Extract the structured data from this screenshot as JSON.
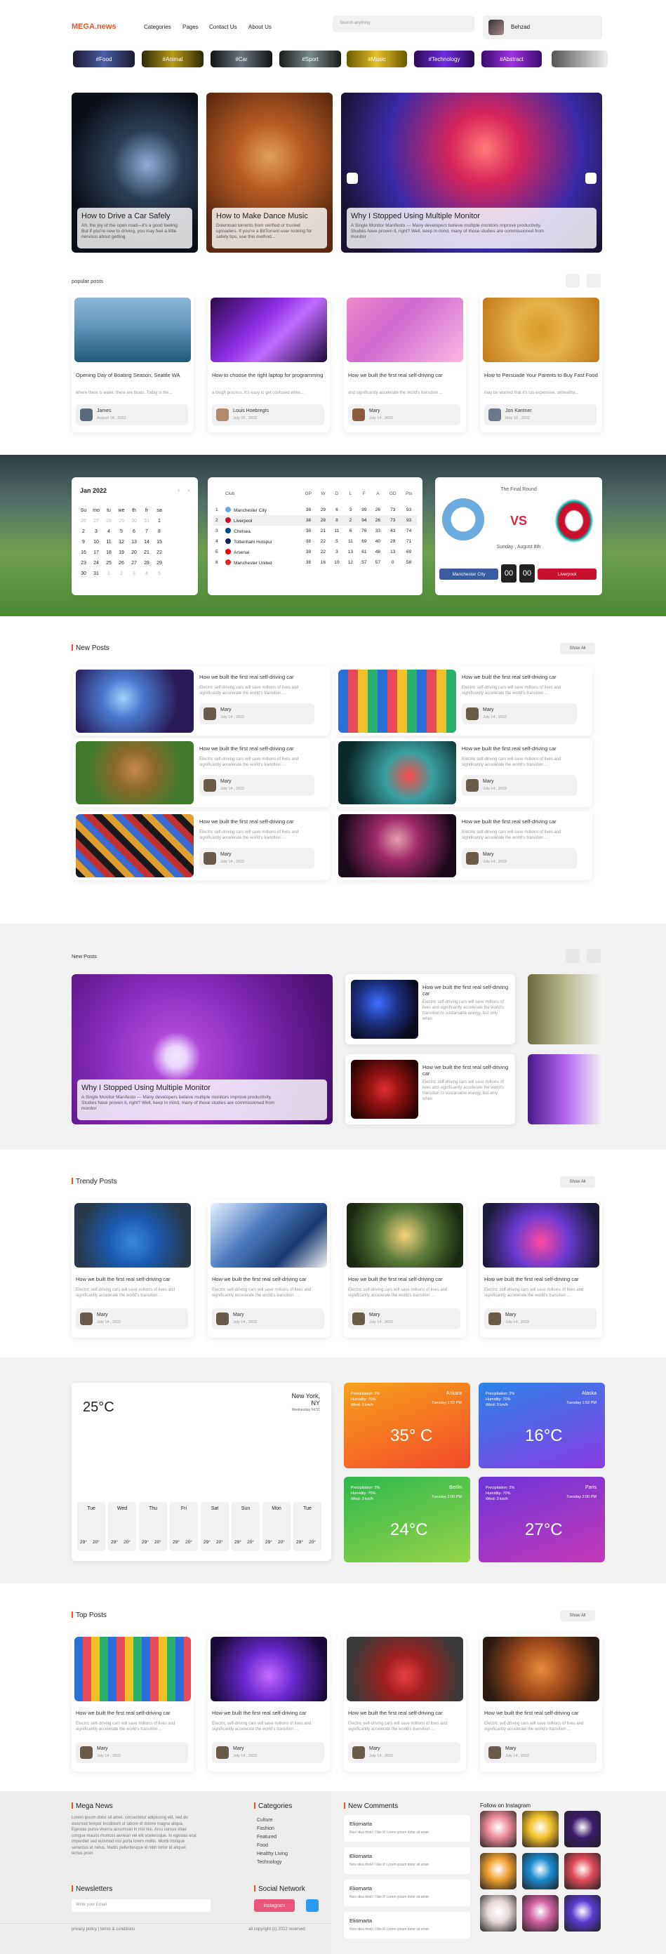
{
  "header": {
    "logo": "MEGA.news",
    "nav": [
      "Categories",
      "Pages",
      "Contact Us",
      "About Us"
    ],
    "search_placeholder": "Search anything",
    "user": "Behzad"
  },
  "tags": [
    "#Food",
    "#Animal",
    "#Car",
    "#Sport",
    "#Music",
    "#Technology",
    "#Abstract"
  ],
  "hero": [
    {
      "title": "How to Drive a Car Safely",
      "desc": "Ah, the joy of the open road—it's a good feeling. But if you're new to driving, you may feel a little nervous about getting"
    },
    {
      "title": "How to Make Dance Music",
      "desc": "Download torrents from verified or trusted uploaders. If you're a BitTorrent user looking for safety tips, use this method..."
    },
    {
      "title": "Why I Stopped Using Multiple Monitor",
      "desc": "A Single Monitor Manifesto — Many developers believe multiple monitors improve productivity. Studies have proven it, right? Well, keep in mind, many of those studies are commissioned from monitor"
    }
  ],
  "popular": {
    "heading": "popular posts",
    "cards": [
      {
        "title": "Opening Day of Boating Season, Seattle WA",
        "desc": "where there is water, there are boats. Today is the...",
        "author": "James",
        "date": "August 18 , 2022"
      },
      {
        "title": "How to choose the right laptop for programming",
        "desc": "a tough process. It's easy to get confused while...",
        "author": "Louis Hoebregts",
        "date": "July 25 , 2022"
      },
      {
        "title": "How we built the first real self-driving car",
        "desc": "and significantly accelerate the world's transition ...",
        "author": "Mary",
        "date": "July 14 , 2022"
      },
      {
        "title": "How to Persuade Your Parents to Buy Fast Food",
        "desc": "may be worried that it's too expensive, unhealthy...",
        "author": "Jon Kantner",
        "date": "May 10 , 2022"
      }
    ]
  },
  "calendar": {
    "month": "Jan 2022",
    "days": [
      "Su",
      "mo",
      "tu",
      "we",
      "th",
      "fr",
      "sa"
    ],
    "rows": [
      [
        "26",
        "27",
        "28",
        "29",
        "30",
        "31",
        "1"
      ],
      [
        "2",
        "3",
        "4",
        "5",
        "6",
        "7",
        "8"
      ],
      [
        "9",
        "10",
        "11",
        "12",
        "13",
        "14",
        "15"
      ],
      [
        "16",
        "17",
        "18",
        "19",
        "20",
        "21",
        "22"
      ],
      [
        "23",
        "24",
        "25",
        "26",
        "27",
        "28",
        "29"
      ],
      [
        "30",
        "31",
        "1",
        "2",
        "3",
        "4",
        "5"
      ]
    ]
  },
  "league": {
    "club_header": "Club",
    "cols": [
      "GP",
      "W",
      "D",
      "L",
      "F",
      "A",
      "GD",
      "Pts"
    ],
    "rows": [
      {
        "pos": "1",
        "club": "Manchester City",
        "vals": [
          "38",
          "29",
          "6",
          "3",
          "99",
          "26",
          "73",
          "93"
        ]
      },
      {
        "pos": "2",
        "club": "Liverpool",
        "vals": [
          "38",
          "28",
          "8",
          "2",
          "94",
          "26",
          "73",
          "93"
        ]
      },
      {
        "pos": "3",
        "club": "Chelsea",
        "vals": [
          "38",
          "21",
          "11",
          "6",
          "76",
          "33",
          "43",
          "74"
        ]
      },
      {
        "pos": "4",
        "club": "Tottenham Hotspur",
        "vals": [
          "38",
          "22",
          "5",
          "11",
          "69",
          "40",
          "29",
          "71"
        ]
      },
      {
        "pos": "5",
        "club": "Arsenal",
        "vals": [
          "38",
          "22",
          "3",
          "13",
          "61",
          "48",
          "13",
          "69"
        ]
      },
      {
        "pos": "6",
        "club": "Manchester United",
        "vals": [
          "38",
          "16",
          "10",
          "12",
          "57",
          "57",
          "0",
          "58"
        ]
      }
    ]
  },
  "match": {
    "round": "The Final Round",
    "vs": "VS",
    "date": "Sunday , August 8th",
    "home": "Manchester City",
    "away": "Liverpool",
    "score_home": "00",
    "score_away": "00",
    "home_color": "#3a5ba0",
    "away_color": "#c8102e"
  },
  "new_posts": {
    "heading": "New Posts",
    "show_all": "Show All",
    "cards": [
      {
        "title": "How we built the first real self-driving car",
        "desc": "Electric self-driving cars will save millions of lives and significantly accelerate the world's transition ...",
        "author": "Mary",
        "date": "July 14 , 2022"
      },
      {
        "title": "How we built the first real self-driving car",
        "desc": "Electric self-driving cars will save millions of lives and significantly accelerate the world's transition ...",
        "author": "Mary",
        "date": "July 14 , 2022"
      },
      {
        "title": "How we built the first real self-driving car",
        "desc": "Electric self-driving cars will save millions of lives and significantly accelerate the world's transition ...",
        "author": "Mary",
        "date": "July 14 , 2022"
      },
      {
        "title": "How we built the first real self-driving car",
        "desc": "Electric self-driving cars will save millions of lives and significantly accelerate the world's transition ...",
        "author": "Mary",
        "date": "July 14 , 2022"
      },
      {
        "title": "How we built the first real self-driving car",
        "desc": "Electric self-driving cars will save millions of lives and significantly accelerate the world's transition ...",
        "author": "Mary",
        "date": "July 14 , 2022"
      },
      {
        "title": "How we built the first real self-driving car",
        "desc": "Electric self-driving cars will save millions of lives and significantly accelerate the world's transition ...",
        "author": "Mary",
        "date": "July 14 , 2022"
      }
    ]
  },
  "new_posts2": {
    "heading": "New Posts",
    "feature_title": "Why I Stopped Using Multiple Monitor",
    "feature_desc": "A Single Monitor Manifesto — Many developers believe multiple monitors improve productivity. Studies have proven it, right? Well, keep in mind, many of those studies are commissioned from monitor",
    "side": [
      {
        "title": "How we built the first real self-driving car",
        "desc": "Electric self-driving cars will save millions of lives and significantly accelerate the world's transition to sustainable energy, but only when"
      },
      {
        "title": "How we built the first real self-driving car",
        "desc": "Electric self-driving cars will save millions of lives and significantly accelerate the world's transition to sustainable energy, but only when"
      }
    ]
  },
  "trendy": {
    "heading": "Trendy Posts",
    "show_all": "Show All",
    "cards": [
      {
        "title": "How we built the first real self-driving car",
        "desc": "Electric self-driving cars will save millions of lives and significantly accelerate the world's transition ...",
        "author": "Mary",
        "date": "July 14 , 2022"
      },
      {
        "title": "How we built the first real self-driving car",
        "desc": "Electric self-driving cars will save millions of lives and significantly accelerate the world's transition ...",
        "author": "Mary",
        "date": "July 14 , 2022"
      },
      {
        "title": "How we built the first real self-driving car",
        "desc": "Electric self-driving cars will save millions of lives and significantly accelerate the world's transition ...",
        "author": "Mary",
        "date": "July 14 , 2022"
      },
      {
        "title": "How we built the first real self-driving car",
        "desc": "Electric self-driving cars will save millions of lives and significantly accelerate the world's transition ...",
        "author": "Mary",
        "date": "July 14 , 2022"
      }
    ]
  },
  "weather": {
    "current_temp": "25°C",
    "city": "New York, NY",
    "day": "Wednesday 04:51",
    "week": [
      {
        "d": "Tue",
        "hi": "29°",
        "lo": "20°"
      },
      {
        "d": "Wed",
        "hi": "29°",
        "lo": "20°"
      },
      {
        "d": "Thu",
        "hi": "29°",
        "lo": "20°"
      },
      {
        "d": "Fri",
        "hi": "29°",
        "lo": "20°"
      },
      {
        "d": "Sat",
        "hi": "29°",
        "lo": "20°"
      },
      {
        "d": "Sun",
        "hi": "29°",
        "lo": "20°"
      },
      {
        "d": "Mon",
        "hi": "29°",
        "lo": "20°"
      },
      {
        "d": "Tue",
        "hi": "29°",
        "lo": "20°"
      }
    ],
    "cities": [
      {
        "city": "Ankara",
        "temp": "35° C",
        "p": "Precipitation: 2%",
        "h": "Humidity: 70%",
        "w": "Wind: 3 km/h",
        "time": "Tuesday 1:53 PM",
        "c1": "#f6a21c",
        "c2": "#f2492a"
      },
      {
        "city": "Alaska",
        "temp": "16°C",
        "p": "Precipitation: 2%",
        "h": "Humidity: 70%",
        "w": "Wind: 3 km/h",
        "time": "Tuesday 1:53 PM",
        "c1": "#2b84e8",
        "c2": "#8a3ce3"
      },
      {
        "city": "Berlin",
        "temp": "24°C",
        "p": "Precipitation: 2%",
        "h": "Humidity: 70%",
        "w": "Wind: 3 km/h",
        "time": "Tuesday 2:00 PM",
        "c1": "#2db84a",
        "c2": "#96d44a"
      },
      {
        "city": "Paris",
        "temp": "27°C",
        "p": "Precipitation: 2%",
        "h": "Humidity: 70%",
        "w": "Wind: 3 km/h",
        "time": "Tuesday 2:00 PM",
        "c1": "#6a35d8",
        "c2": "#c738b8"
      }
    ]
  },
  "top": {
    "heading": "Top Posts",
    "show_all": "Show All",
    "cards": [
      {
        "title": "How we built the first real self-driving car",
        "desc": "Electric self-driving cars will save millions of lives and significantly accelerate the world's transition ...",
        "author": "Mary",
        "date": "July 14 , 2022"
      },
      {
        "title": "How we built the first real self-driving car",
        "desc": "Electric self-driving cars will save millions of lives and significantly accelerate the world's transition ...",
        "author": "Mary",
        "date": "July 14 , 2022"
      },
      {
        "title": "How we built the first real self-driving car",
        "desc": "Electric self-driving cars will save millions of lives and significantly accelerate the world's transition ...",
        "author": "Mary",
        "date": "July 14 , 2022"
      },
      {
        "title": "How we built the first real self-driving car",
        "desc": "Electric self-driving cars will save millions of lives and significantly accelerate the world's transition ...",
        "author": "Mary",
        "date": "July 14 , 2022"
      }
    ]
  },
  "footer": {
    "about_title": "Mega News",
    "about_text": "Lorem ipsum dolor sit amet, consectetur adipiscing elit, sed do eiusmod tempor incididunt ut labore et dolore magna aliqua. Egestas purus viverra accumsan in nisl nisi. Arcu cursus vitae congue mauris rhoncus aenean vel elit scelerisque. In egestas erat imperdiet sed euismod nisi porta lorem mollis. Morbi tristique senectus et netus. Mattis pellentesque id nibh tortor id aliquet lectus proin",
    "newsletter_title": "Newsletters",
    "newsletter_placeholder": "Write your Email",
    "categories_title": "Categories",
    "categories": [
      "Culture",
      "Fashion",
      "Featured",
      "Food",
      "Healthy Living",
      "Technology"
    ],
    "social_title": "Social Network",
    "social_btn": "instagram",
    "comments_title": "New Comments",
    "comments": [
      {
        "name": "Eliornarta",
        "text": "Nice idea think! I like it! Lorem ipsum dolor sit amet"
      },
      {
        "name": "Eliornarta",
        "text": "Nice idea think! I like it! Lorem ipsum dolor sit amet"
      },
      {
        "name": "Eliornarta",
        "text": "Nice idea think! I like it! Lorem ipsum dolor sit amet"
      },
      {
        "name": "Eliornarta",
        "text": "Nice idea think! I like it! Lorem ipsum dolor sit amet"
      }
    ],
    "insta_title": "Follow on Instagram",
    "privacy": "privacy policy | terms & conditions",
    "copyright": "all copyright (c) 2022 reserved"
  }
}
